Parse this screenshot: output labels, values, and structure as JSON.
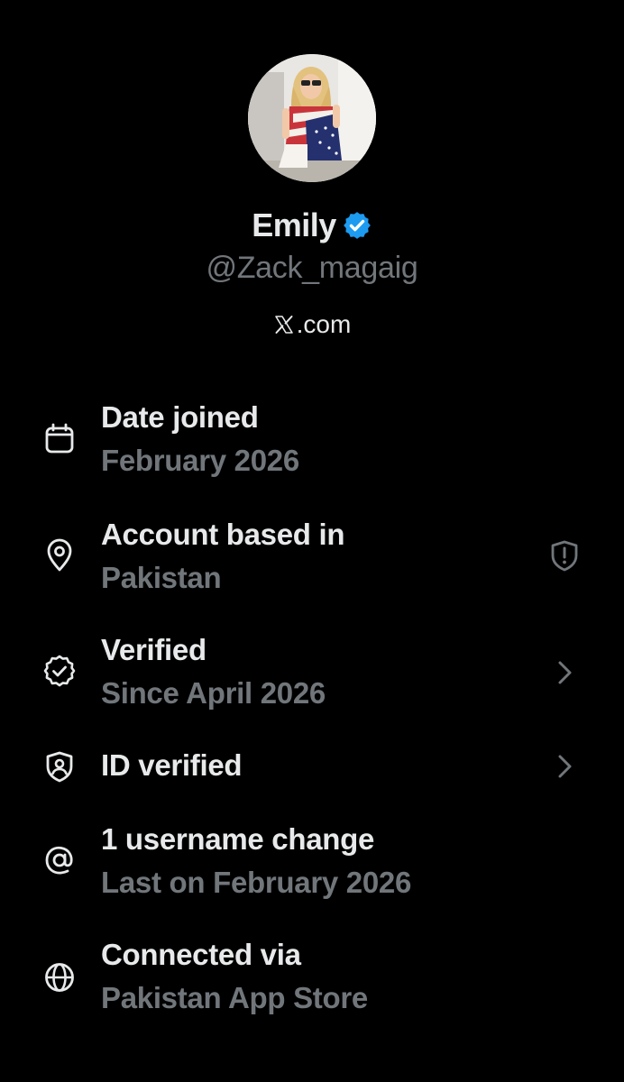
{
  "profile": {
    "display_name": "Emily",
    "handle": "@Zack_magaig",
    "site_suffix": ".com",
    "verified_badge_color": "#1d9bf0"
  },
  "about_rows": [
    {
      "icon": "calendar-icon",
      "title": "Date joined",
      "subtitle": "February 2026"
    },
    {
      "icon": "location-pin-icon",
      "title": "Account based in",
      "subtitle": "Pakistan",
      "trailing": "shield-alert-icon"
    },
    {
      "icon": "verified-check-icon",
      "title": "Verified",
      "subtitle": "Since April 2026",
      "trailing": "chevron-right-icon"
    },
    {
      "icon": "id-shield-icon",
      "title": "ID verified",
      "trailing": "chevron-right-icon"
    },
    {
      "icon": "at-sign-icon",
      "title": "1 username change",
      "subtitle": "Last on February 2026"
    },
    {
      "icon": "globe-icon",
      "title": "Connected via",
      "subtitle": "Pakistan App Store"
    }
  ],
  "colors": {
    "background": "#000000",
    "primary_text": "#e7e9ea",
    "secondary_text": "#71767b",
    "accent": "#1d9bf0"
  }
}
